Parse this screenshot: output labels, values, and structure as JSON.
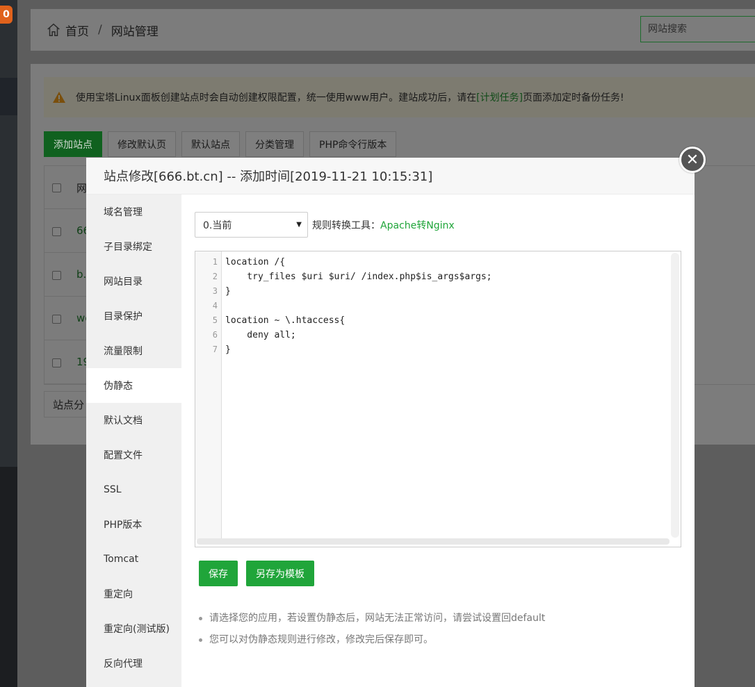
{
  "notification_count": "0",
  "breadcrumb": {
    "home": "首页",
    "separator": "/",
    "current": "网站管理"
  },
  "search": {
    "placeholder": "网站搜索"
  },
  "notice": {
    "text_before": "使用宝塔Linux面板创建站点时会自动创建权限配置，统一使用www用户。建站成功后，请在",
    "link": "[计划任务]",
    "text_after": "页面添加定时备份任务!"
  },
  "toolbar": [
    "添加站点",
    "修改默认页",
    "默认站点",
    "分类管理",
    "PHP命令行版本"
  ],
  "table": {
    "header_partial": "网",
    "rows_partial": [
      "66",
      "b.",
      "we",
      "19"
    ]
  },
  "footer_partial": "站点分",
  "modal": {
    "title": "站点修改[666.bt.cn] -- 添加时间[2019-11-21 10:15:31]",
    "close_label": "✕",
    "menu": [
      "域名管理",
      "子目录绑定",
      "网站目录",
      "目录保护",
      "流量限制",
      "伪静态",
      "默认文档",
      "配置文件",
      "SSL",
      "PHP版本",
      "Tomcat",
      "重定向",
      "重定向(测试版)",
      "反向代理"
    ],
    "active_menu": "伪静态",
    "rule_select": {
      "value": "0.当前"
    },
    "rule_tool_label": "规则转换工具：",
    "rule_tool_link": "Apache转Nginx",
    "code_lines": [
      "location /{",
      "    try_files $uri $uri/ /index.php$is_args$args;",
      "}",
      "",
      "location ~ \\.htaccess{",
      "    deny all;",
      "}"
    ],
    "line_numbers": [
      "1",
      "2",
      "3",
      "4",
      "5",
      "6",
      "7"
    ],
    "buttons": {
      "save": "保存",
      "save_template": "另存为模板"
    },
    "tips": [
      "请选择您的应用，若设置伪静态后，网站无法正常访问，请尝试设置回default",
      "您可以对伪静态规则进行修改，修改完后保存即可。"
    ]
  },
  "colors": {
    "accent": "#20a53a",
    "overlay_bg": "#5d5d5d"
  }
}
